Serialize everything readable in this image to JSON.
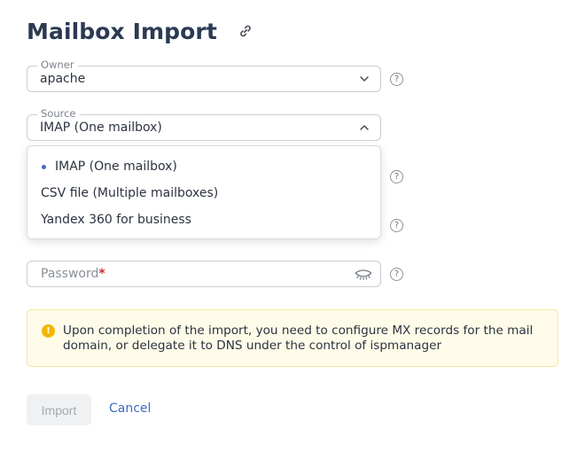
{
  "page": {
    "title": "Mailbox Import"
  },
  "form": {
    "owner": {
      "label": "Owner",
      "value": "apache"
    },
    "source": {
      "label": "Source",
      "value": "IMAP (One mailbox)",
      "options": [
        "IMAP (One mailbox)",
        "CSV file (Multiple mailboxes)",
        "Yandex 360 for business"
      ],
      "selected_index": 0
    },
    "password": {
      "placeholder": "Password",
      "required_mark": "*"
    },
    "help_glyph": "?"
  },
  "notice": {
    "icon_glyph": "!",
    "text": "Upon completion of the import, you need to configure MX records for the mail domain, or delegate it to DNS under the control of ispmanager"
  },
  "actions": {
    "import_label": "Import",
    "cancel_label": "Cancel"
  },
  "colors": {
    "accent": "#3d69c0",
    "notice_bg": "#fefbe8",
    "notice_icon": "#f2b705",
    "required": "#d22b2b"
  },
  "icons": {
    "copy_link": "link-icon",
    "owner_dropdown": "chevron-down-icon",
    "source_dropdown": "chevron-up-icon",
    "password_toggle": "eye-closed-icon",
    "help": "help-icon",
    "notice": "warning-icon"
  }
}
